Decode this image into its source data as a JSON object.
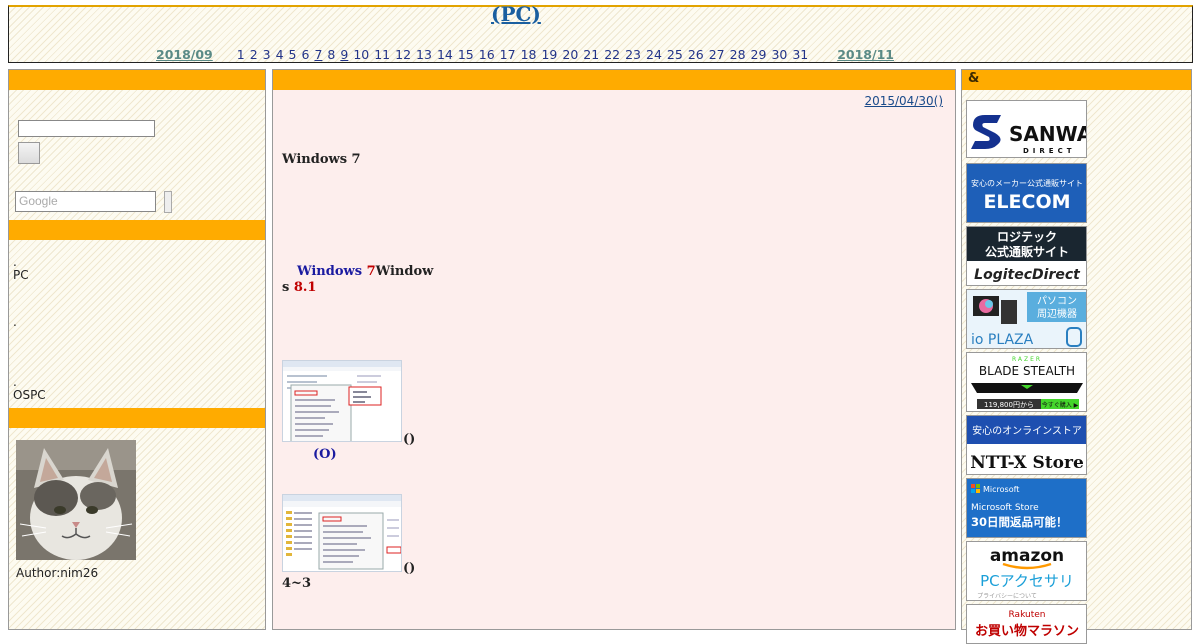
{
  "header": {
    "title": "(PC)",
    "calendar": {
      "prev": "2018/09",
      "next": "2018/11",
      "days": [
        "1",
        "2",
        "3",
        "4",
        "5",
        "6",
        "7",
        "8",
        "9",
        "10",
        "11",
        "12",
        "13",
        "14",
        "15",
        "16",
        "17",
        "18",
        "19",
        "20",
        "21",
        "22",
        "23",
        "24",
        "25",
        "26",
        "27",
        "28",
        "29",
        "30",
        "31"
      ],
      "linked_days": [
        "7",
        "9"
      ]
    }
  },
  "left": {
    "google_placeholder": "Google",
    "text1": "PC",
    "text2": "OSPC",
    "author": "Author:nim26"
  },
  "center": {
    "date": "2015/04/30()",
    "line1": "Windows 7",
    "line2_a": "Windows ",
    "line2_b": "7",
    "line2_c": "Window",
    "line3_a": "s ",
    "line3_b": "8.1",
    "cap1": "()",
    "cap1b": "(O)",
    "cap2": "()",
    "cap2b": "4~3"
  },
  "right": {
    "title": "&",
    "banners": {
      "sanwa_1": "SANWA",
      "sanwa_2": "DIRECT",
      "elecom_1": "安心のメーカー公式通販サイト",
      "elecom_2": "ELECOM",
      "logitec_1": "ロジテック",
      "logitec_2": "公式通販サイト",
      "logitec_3": "LogitecDirect",
      "ioplaza_1": "パソコン",
      "ioplaza_2": "周辺機器",
      "ioplaza_3": "io PLAZA",
      "razer_1": "RAZER",
      "razer_2": "BLADE STEALTH",
      "razer_3": "119,800円から",
      "razer_4": "今すぐ購入 ▶",
      "nttx_1": "安心のオンラインストア",
      "nttx_2": "NTT-X Store",
      "ms_1": "Microsoft",
      "ms_2": "Microsoft Store",
      "ms_3": "30日間返品可能！",
      "amazon_1": "amazon",
      "amazon_2": "PCアクセサリ",
      "amazon_3": "プライバシーについて",
      "rakuten_1": "Rakuten",
      "rakuten_2": "お買い物マラソン"
    }
  },
  "colors": {
    "bar": "#ffab00",
    "center_bg": "#fdeeed",
    "title_link": "#1a5fa0"
  }
}
